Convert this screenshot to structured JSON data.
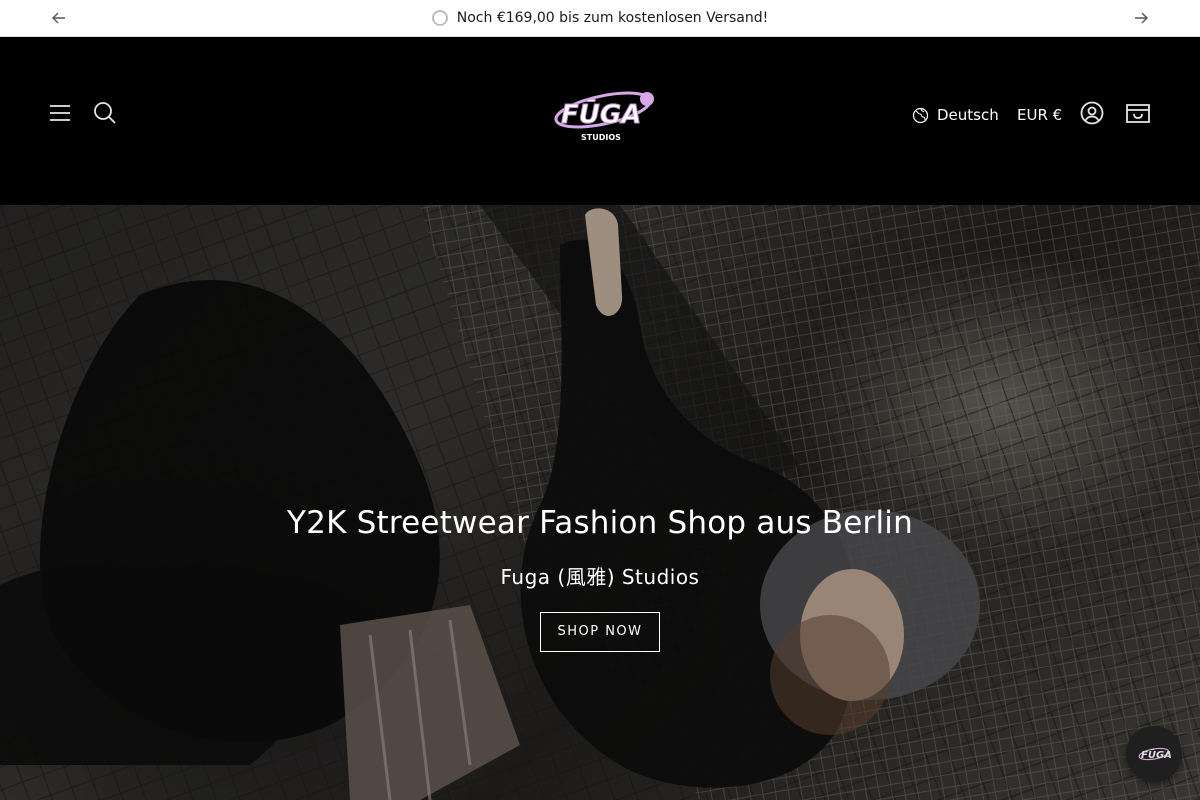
{
  "announcement": {
    "message": "Noch €169,00 bis zum kostenlosen Versand!",
    "progress_fraction": 0.0
  },
  "header": {
    "logo_alt": "Fuga Studios",
    "language": "Deutsch",
    "currency": "EUR €",
    "icons": [
      "menu-icon",
      "search-icon",
      "globe-icon",
      "account-icon",
      "cart-icon"
    ]
  },
  "hero": {
    "title": "Y2K Streetwear Fashion Shop aus Berlin",
    "subtitle": "Fuga (風雅) Studios",
    "cta": "SHOP NOW"
  },
  "colors": {
    "header_bg": "#000000",
    "announcement_bg": "#ffffff",
    "logo_accent": "#d9a6e8"
  }
}
